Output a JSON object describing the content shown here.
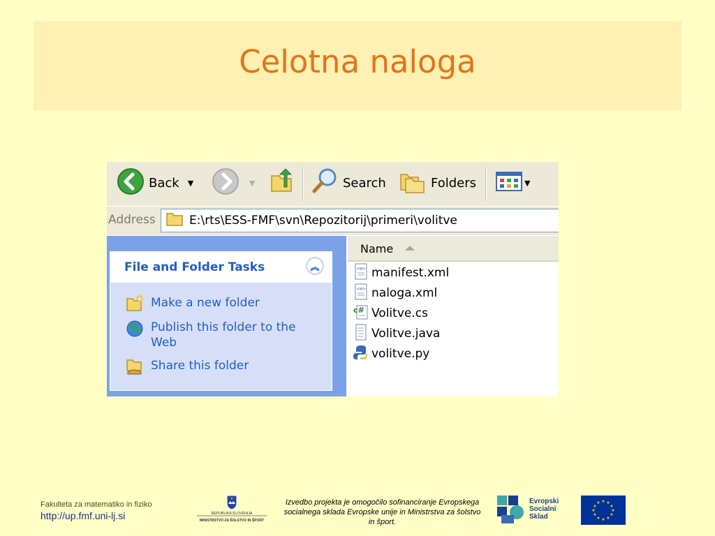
{
  "slide": {
    "title": "Celotna naloga"
  },
  "toolbar": {
    "back_label": "Back",
    "search_label": "Search",
    "folders_label": "Folders"
  },
  "address": {
    "label": "Address",
    "path": "E:\\rts\\ESS-FMF\\svn\\Repozitorij\\primeri\\volitve"
  },
  "tasks": {
    "header": "File and Folder Tasks",
    "items": [
      {
        "label": "Make a new folder",
        "icon": "new-folder-icon"
      },
      {
        "label": "Publish this folder to the Web",
        "icon": "publish-web-icon"
      },
      {
        "label": "Share this folder",
        "icon": "share-folder-icon"
      }
    ]
  },
  "filelist": {
    "column_name": "Name",
    "files": [
      {
        "name": "manifest.xml",
        "icon": "xml-file-icon"
      },
      {
        "name": "naloga.xml",
        "icon": "xml-file-icon"
      },
      {
        "name": "Volitve.cs",
        "icon": "csharp-file-icon"
      },
      {
        "name": "Volitve.java",
        "icon": "java-file-icon"
      },
      {
        "name": "volitve.py",
        "icon": "python-file-icon"
      }
    ]
  },
  "footer": {
    "faculty": "Fakulteta za matematiko in fiziko",
    "url": "http://up.fmf.uni-lj.si",
    "ministry_line1": "REPUBLIKA SLOVENIJA",
    "ministry_line2": "MINISTRSTVO ZA ŠOLSTVO IN ŠPORT",
    "funding_note": "Izvedbo projekta je omogočilo sofinanciranje Evropskega socialnega sklada Evropske unije in Ministrstva za šolstvo in šport.",
    "esf_line1": "Evropski",
    "esf_line2": "Socialni",
    "esf_line3": "Sklad"
  },
  "colors": {
    "background": "#ffffc6",
    "title_band": "#fff0b4",
    "title_text": "#e3751a",
    "xp_task_blue": "#215dc6"
  }
}
